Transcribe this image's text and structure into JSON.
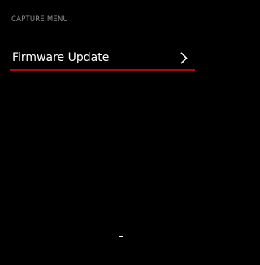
{
  "header": {
    "title": "CAPTURE MENU"
  },
  "menu": {
    "items": [
      {
        "label": "Firmware Update",
        "icon": "chevron-right-icon",
        "selected": true
      }
    ]
  },
  "pagination": {
    "total": 3,
    "current": 3
  },
  "colors": {
    "background": "#000000",
    "header_text": "#8e8e8e",
    "item_text": "#ffffff",
    "accent": "#b1050f"
  }
}
